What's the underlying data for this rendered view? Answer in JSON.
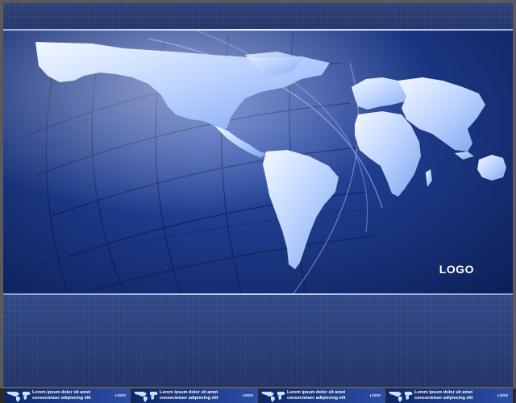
{
  "hero": {
    "logo": "LOGO"
  },
  "thumbnails": [
    {
      "line1": "Lorem ipsum dolor sit amet",
      "line2": "consectetuer adipiscing elit",
      "logo": "LOGO"
    },
    {
      "line1": "Lorem ipsum dolor sit amet",
      "line2": "consectetuer adipiscing elit",
      "logo": "LOGO"
    },
    {
      "line1": "Lorem ipsum dolor sit amet",
      "line2": "consectetuer adipiscing elit",
      "logo": "LOGO"
    },
    {
      "line1": "Lorem ipsum dolor sit amet",
      "line2": "consectetuer adipiscing elit",
      "logo": "LOGO"
    }
  ],
  "colors": {
    "background": "#5a5a5a",
    "band": "#1c2f63",
    "hero_center": "#3b5cb8",
    "continent": "#cfe0ff"
  },
  "icons": [
    "world-map-illustration",
    "globe-grid-lines"
  ]
}
